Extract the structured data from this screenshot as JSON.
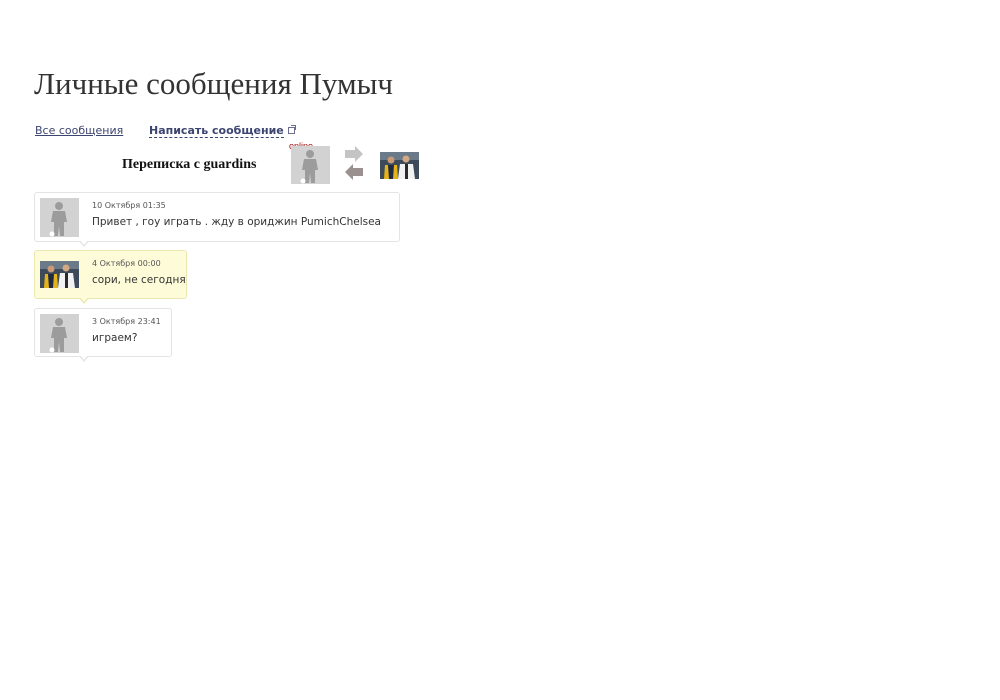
{
  "page": {
    "title": "Личные сообщения Пумыч"
  },
  "nav": {
    "all_messages": "Все сообщения",
    "write_message": "Написать сообщение",
    "write_message_icon": "popup-icon"
  },
  "conversation": {
    "title": "Переписка с guardins",
    "status": "online",
    "swap_icon": "swap-arrows-icon",
    "colors": {
      "own_bubble": "#fefcd8",
      "other_bubble": "#ffffff",
      "online": "#a01010",
      "link": "#3c4470"
    }
  },
  "messages": [
    {
      "date": "10 Октября 01:35",
      "text": "Привет , гоу играть . жду в ориджин PumichChelsea",
      "author_avatar": "default-avatar"
    },
    {
      "date": "4 Октября 00:00",
      "text": "сори, не сегодня",
      "author_avatar": "user-photo-avatar"
    },
    {
      "date": "3 Октября 23:41",
      "text": "играем?",
      "author_avatar": "default-avatar"
    }
  ]
}
